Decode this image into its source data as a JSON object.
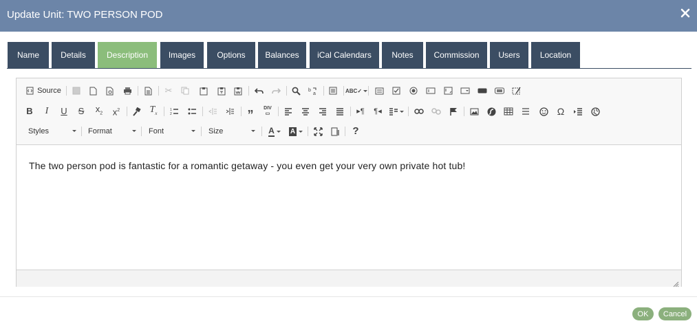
{
  "dialog": {
    "title": "Update Unit: TWO PERSON POD"
  },
  "tabs": [
    {
      "label": "Name"
    },
    {
      "label": "Details"
    },
    {
      "label": "Description",
      "active": true
    },
    {
      "label": "Images"
    },
    {
      "label": "Options"
    },
    {
      "label": "Balances"
    },
    {
      "label": "iCal Calendars"
    },
    {
      "label": "Notes"
    },
    {
      "label": "Commission"
    },
    {
      "label": "Users"
    },
    {
      "label": "Location"
    }
  ],
  "editor": {
    "source_label": "Source",
    "styles_label": "Styles",
    "format_label": "Format",
    "font_label": "Font",
    "size_label": "Size",
    "text_color_label": "A",
    "bg_color_label": "A",
    "help_label": "?",
    "content": "The two person pod is fantastic for a romantic getaway - you even get your very own private hot tub!"
  },
  "buttons": {
    "ok": "OK",
    "cancel": "Cancel"
  },
  "colors": {
    "titlebar": "#6c85a8",
    "tab": "#3b4d63",
    "tab_active": "#8bbd7b",
    "button": "#8bb07d"
  }
}
